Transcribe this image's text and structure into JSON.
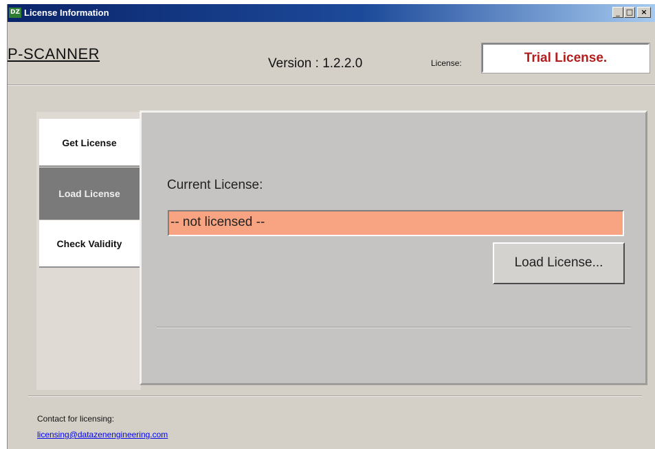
{
  "window": {
    "title": "License Information",
    "icon_text": "DZ",
    "controls": {
      "minimize": "_",
      "maximize": "□",
      "close": "×"
    }
  },
  "header": {
    "app_name": "P-SCANNER",
    "version": "Version : 1.2.2.0",
    "license_caption": "License:",
    "license_value": "Trial License.",
    "license_value_color": "#b21d1d"
  },
  "tabs": [
    {
      "label": "Get License",
      "selected": false
    },
    {
      "label": "Load License",
      "selected": true
    },
    {
      "label": "Check Validity",
      "selected": false
    }
  ],
  "content": {
    "current_license_label": "Current License:",
    "current_license_value": "-- not licensed --",
    "field_color": "#f8a482",
    "load_button_label": "Load License..."
  },
  "footer": {
    "contact_label": "Contact for licensing:",
    "contact_email": "licensing@datazenengineering.com"
  }
}
